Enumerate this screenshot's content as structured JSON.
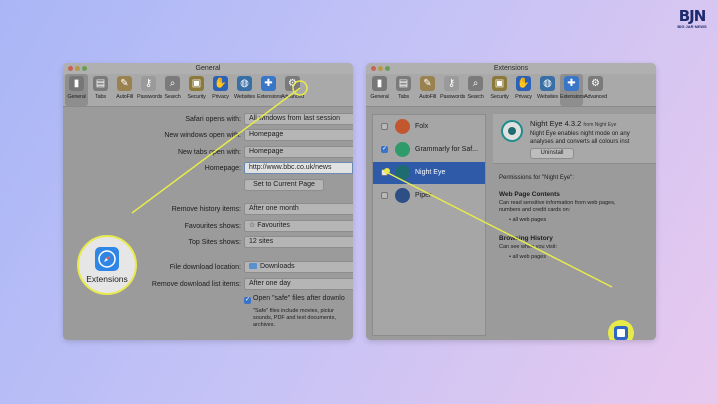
{
  "logo": {
    "text": "BJN",
    "sub": "BIG JAR NEWS"
  },
  "left": {
    "title": "General",
    "toolbar": [
      {
        "label": "General",
        "icon": "phone-icon",
        "color": "#777777"
      },
      {
        "label": "Tabs",
        "icon": "tabs-icon",
        "color": "#7a7a7a"
      },
      {
        "label": "AutoFill",
        "icon": "pencil-icon",
        "color": "#9a8250"
      },
      {
        "label": "Passwords",
        "icon": "key-icon",
        "color": "#9a9a9a"
      },
      {
        "label": "Search",
        "icon": "search-icon",
        "color": "#7b7b7b"
      },
      {
        "label": "Security",
        "icon": "lock-icon",
        "color": "#8c7a3c"
      },
      {
        "label": "Privacy",
        "icon": "hand-icon",
        "color": "#2c62b5"
      },
      {
        "label": "Websites",
        "icon": "globe-icon",
        "color": "#3a6fa6"
      },
      {
        "label": "Extensions",
        "icon": "puzzle-icon",
        "color": "#3a76c7"
      },
      {
        "label": "Advanced",
        "icon": "gear-icon",
        "color": "#7a7a7a"
      }
    ],
    "rows": [
      {
        "label": "Safari opens with:",
        "value": "All windows from last session"
      },
      {
        "label": "New windows open with:",
        "value": "Homepage"
      },
      {
        "label": "New tabs open with:",
        "value": "Homepage"
      },
      {
        "label": "Homepage:",
        "value": "http://www.bbc.co.uk/news"
      },
      {
        "label": "Remove history items:",
        "value": "After one month"
      },
      {
        "label": "Favourites shows:",
        "value": "☆ Favourites"
      },
      {
        "label": "Top Sites shows:",
        "value": "12 sites"
      },
      {
        "label": "File download location:",
        "value": "Downloads"
      },
      {
        "label": "Remove download list items:",
        "value": "After one day"
      }
    ],
    "set_current_button": "Set to Current Page",
    "open_safe_label": "Open \"safe\" files after downlo",
    "safe_note": "\"Safe\" files include movies, pictur sounds, PDF and text documents, archives.",
    "zoom_label": "Extensions"
  },
  "right": {
    "title": "Extensions",
    "toolbar": [
      {
        "label": "General",
        "icon": "phone-icon",
        "color": "#777777"
      },
      {
        "label": "Tabs",
        "icon": "tabs-icon",
        "color": "#7a7a7a"
      },
      {
        "label": "AutoFill",
        "icon": "pencil-icon",
        "color": "#9a8250"
      },
      {
        "label": "Passwords",
        "icon": "key-icon",
        "color": "#9a9a9a"
      },
      {
        "label": "Search",
        "icon": "search-icon",
        "color": "#7b7b7b"
      },
      {
        "label": "Security",
        "icon": "lock-icon",
        "color": "#8c7a3c"
      },
      {
        "label": "Privacy",
        "icon": "hand-icon",
        "color": "#2c62b5"
      },
      {
        "label": "Websites",
        "icon": "globe-icon",
        "color": "#3a6fa6"
      },
      {
        "label": "Extensions",
        "icon": "puzzle-icon",
        "color": "#3a76c7"
      },
      {
        "label": "Advanced",
        "icon": "gear-icon",
        "color": "#7a7a7a"
      }
    ],
    "extensions": [
      {
        "name": "Folx",
        "checked": false,
        "color": "#c2562f"
      },
      {
        "name": "Grammarly for Saf...",
        "checked": true,
        "color": "#2f9a6a"
      },
      {
        "name": "Night Eye",
        "checked": false,
        "color": "#1f6c70"
      },
      {
        "name": "Piper",
        "checked": false,
        "color": "#2e4e86"
      }
    ],
    "detail": {
      "name": "Night Eye 4.3.2",
      "from": "from Night Eye",
      "desc1": "Night Eye enables night mode on any",
      "desc2": "analyses and converts all colours inst",
      "uninstall": "Uninstall",
      "permissions_title": "Permissions for \"Night Eye\":",
      "web_title": "Web Page Contents",
      "web_desc1": "Can read sensitive information from web pages,",
      "web_desc2": "numbers and credit cards on:",
      "web_bullet": "• all web pages",
      "hist_title": "Browsing History",
      "hist_desc": "Can see when you visit:",
      "hist_bullet": "• all web pages"
    }
  }
}
